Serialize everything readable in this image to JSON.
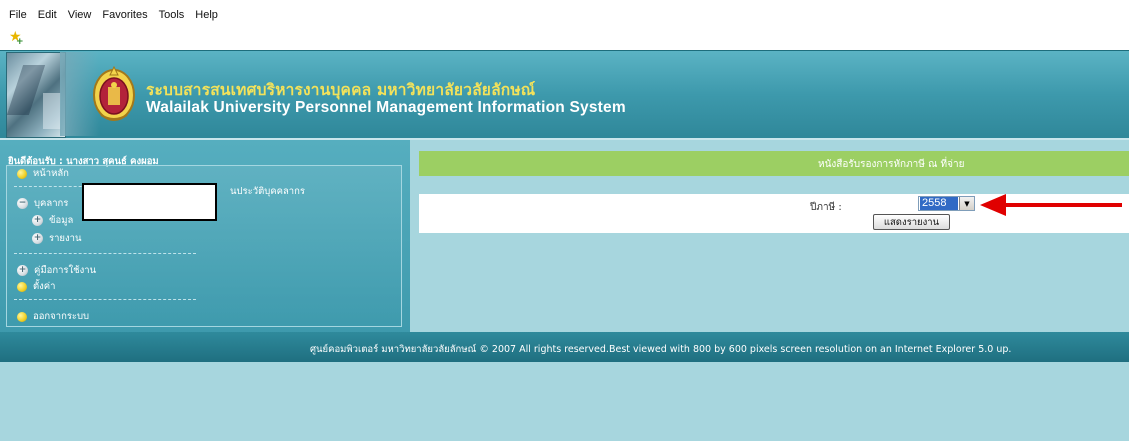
{
  "menubar": {
    "items": [
      "File",
      "Edit",
      "View",
      "Favorites",
      "Tools",
      "Help"
    ]
  },
  "toolbar": {
    "favorites_icon": "star-plus-icon"
  },
  "header": {
    "title_thai": "ระบบสารสนเทศบริหารงานบุคคล มหาวิทยาลัยวลัยลักษณ์",
    "title_en": "Walailak University Personnel Management Information System",
    "seal_icon": "university-seal-icon"
  },
  "sidebar": {
    "welcome": "ยินดีต้อนรับ : นางสาว สุคนธ์ คงผอม",
    "items": [
      {
        "label": "หน้าหลัก",
        "icon": "yellow-dot-icon"
      },
      {
        "label": "บุคลากร",
        "icon": "minus-circle-icon"
      },
      {
        "label": "ข้อมูล",
        "icon": "plus-circle-icon"
      },
      {
        "label": "รายงาน",
        "icon": "plus-circle-icon"
      },
      {
        "label": "คู่มือการใช้งาน",
        "icon": "plus-circle-icon"
      },
      {
        "label": "ตั้งค่า",
        "icon": "yellow-dot-icon"
      },
      {
        "label": "ออกจากระบบ",
        "icon": "yellow-dot-icon"
      }
    ],
    "section_text": "นประวัติบุคคลากร"
  },
  "main": {
    "doc_title": "หนังสือรับรองการหักภาษี ณ ที่จ่าย",
    "year_label": "ปีภาษี :",
    "year_value": "2558",
    "show_button": "แสดงรายงาน"
  },
  "footer": {
    "text": "ศูนย์คอมพิวเตอร์ มหาวิทยาลัยวลัยลักษณ์ © 2007 All rights reserved.Best viewed with 800 by 600 pixels screen resolution on an Internet Explorer 5.0 up."
  },
  "colors": {
    "banner": "#3d99ac",
    "title_thai": "#f3e25a",
    "title_bar": "#9ccf63",
    "page_bg": "#a7d6de",
    "annotation_arrow": "#e00000"
  }
}
